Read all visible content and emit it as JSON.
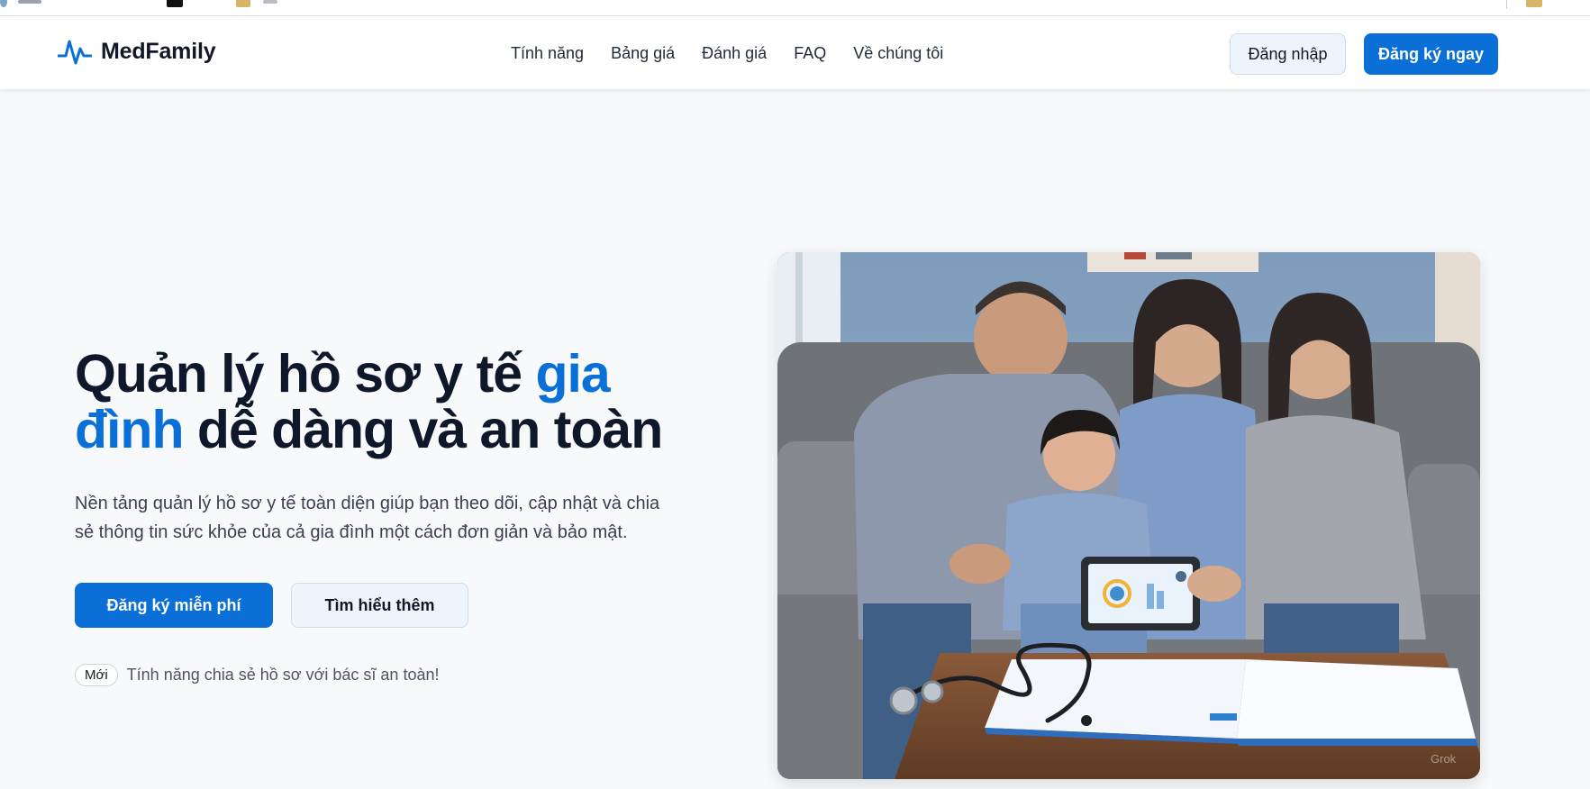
{
  "header": {
    "brand": "MedFamily",
    "nav": [
      "Tính năng",
      "Bảng giá",
      "Đánh giá",
      "FAQ",
      "Về chúng tôi"
    ],
    "login_label": "Đăng nhập",
    "signup_label": "Đăng ký ngay"
  },
  "hero": {
    "title_part1": "Quản lý hồ sơ y tế ",
    "title_accent": "gia đình",
    "title_part2": " dễ dàng và an toàn",
    "description": "Nền tảng quản lý hồ sơ y tế toàn diện giúp bạn theo dõi, cập nhật và chia sẻ thông tin sức khỏe của cả gia đình một cách đơn giản và bảo mật.",
    "primary_cta": "Đăng ký miễn phí",
    "secondary_cta": "Tìm hiểu thêm",
    "badge": "Mới",
    "badge_text": "Tính năng chia sẻ hồ sơ với bác sĩ an toàn!"
  },
  "image": {
    "watermark": "Grok"
  },
  "colors": {
    "accent": "#0a6fd6",
    "text": "#0f172a",
    "background": "#f7f9fb"
  }
}
